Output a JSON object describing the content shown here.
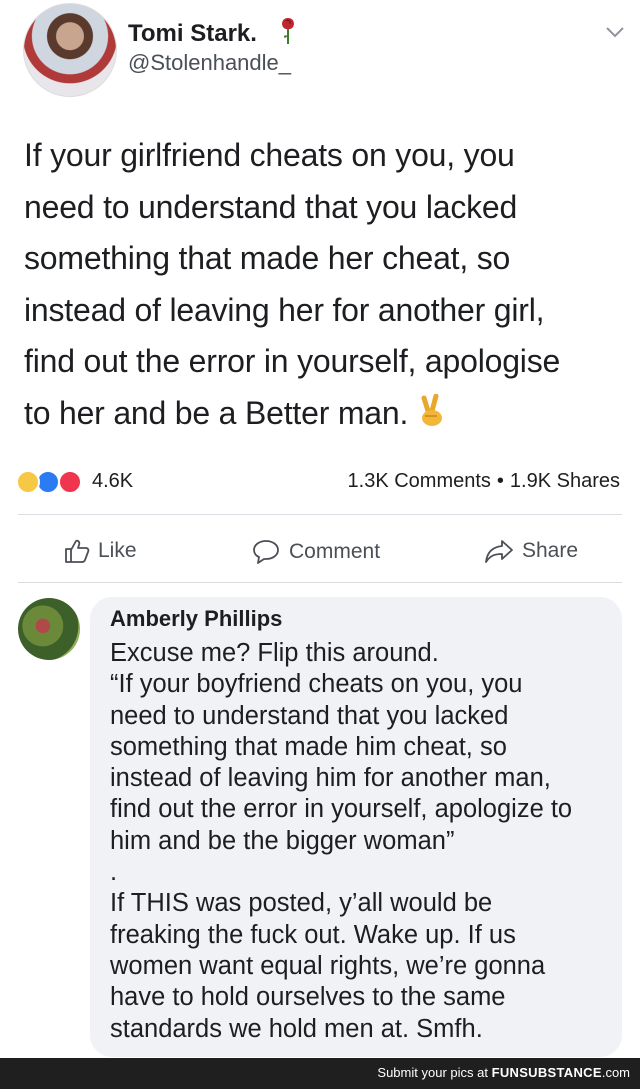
{
  "post": {
    "author_name": "Tomi Stark.",
    "author_handle": "@Stolenhandle_",
    "text_lines": [
      "If your girlfriend cheats on you, you",
      "need to understand that you lacked",
      "something that made her cheat, so",
      "instead of leaving her for another girl,",
      "find out the error in yourself, apologise",
      "to her and be a Better man."
    ],
    "reactions_count": "4.6K",
    "comments_count": "1.3K Comments",
    "separator": "•",
    "shares_count": "1.9K Shares",
    "reaction_icons": [
      "haha-icon",
      "like-icon",
      "love-icon"
    ]
  },
  "actions": {
    "like": "Like",
    "comment": "Comment",
    "share": "Share"
  },
  "comment": {
    "author_name": "Amberly Phillips",
    "lines": [
      "Excuse me? Flip this around.",
      "“If your boyfriend cheats on you, you",
      "need to understand that you lacked",
      "something that made him cheat, so",
      "instead of leaving him for another man,",
      "find out the error in yourself, apologize to",
      "him and be the bigger woman”",
      ".",
      "If THIS was posted, y’all would be",
      "freaking the fuck out. Wake up. If us",
      "women want equal rights, we’re gonna",
      "have to hold ourselves to the same",
      "standards we hold men at. Smfh."
    ]
  },
  "footer": {
    "prefix": "Submit your pics at",
    "brand": "FUNSUBSTANCE",
    "suffix": ".com"
  },
  "colors": {
    "text": "#1c1e21",
    "secondary": "#4b4f56",
    "bubble": "#f0f2f5",
    "like_blue": "#2b7bf3",
    "love_red": "#f0354e",
    "haha_yellow": "#f7c846"
  }
}
